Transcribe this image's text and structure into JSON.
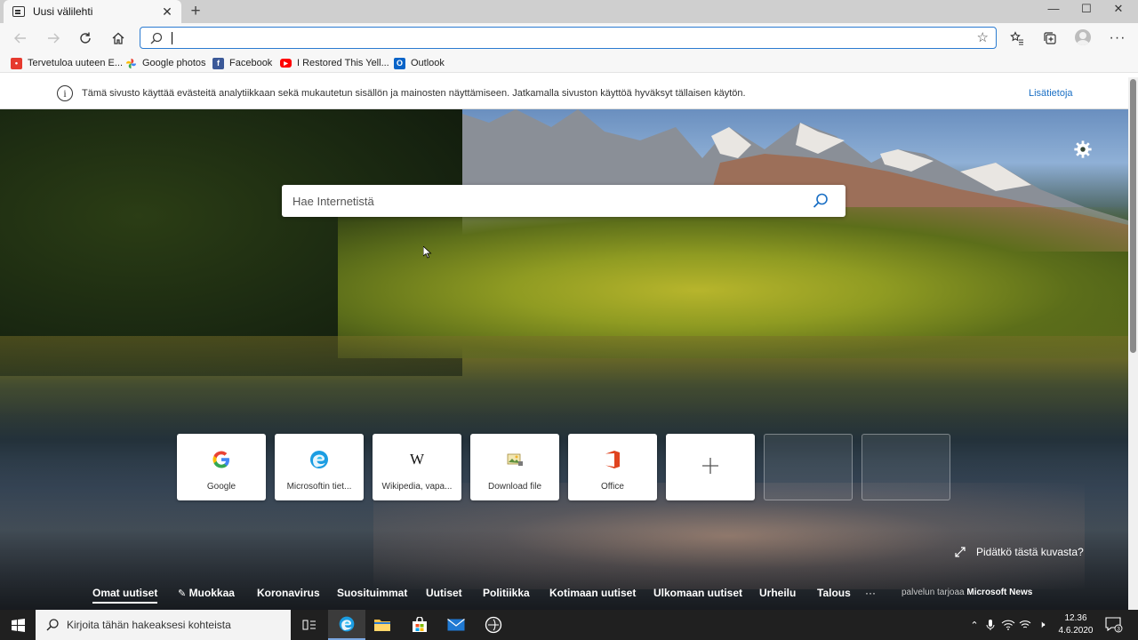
{
  "tab": {
    "title": "Uusi välilehti",
    "close": "✕",
    "new_tab": "+"
  },
  "window": {
    "minimize": "—",
    "maximize": "☐",
    "close": "✕"
  },
  "address_bar": {
    "value": "",
    "placeholder": ""
  },
  "favorites": [
    {
      "label": "Tervetuloa uuteen E...",
      "icon": "welcome-icon",
      "color": "#e63a2e"
    },
    {
      "label": "Google photos",
      "icon": "pinwheel-icon",
      "color": "#fbbc05"
    },
    {
      "label": "Facebook",
      "icon": "facebook-icon",
      "color": "#3b5998"
    },
    {
      "label": "I Restored This Yell...",
      "icon": "youtube-icon",
      "color": "#ff0000"
    },
    {
      "label": "Outlook",
      "icon": "outlook-icon",
      "color": "#0a64c8"
    }
  ],
  "notice": {
    "text": "Tämä sivusto käyttää evästeitä analytiikkaan sekä mukautetun sisällön ja mainosten näyttämiseen. Jatkamalla sivuston käyttöä hyväksyt tällaisen käytön.",
    "link": "Lisätietoja",
    "info_glyph": "i"
  },
  "search": {
    "placeholder": "Hae Internetistä"
  },
  "quick_links": [
    {
      "label": "Google",
      "icon": "google-icon"
    },
    {
      "label": "Microsoftin tiet...",
      "icon": "edge-icon"
    },
    {
      "label": "Wikipedia, vapa...",
      "icon": "wikipedia-icon",
      "glyph": "W"
    },
    {
      "label": "Download file",
      "icon": "download-file-icon"
    },
    {
      "label": "Office",
      "icon": "office-icon"
    }
  ],
  "photo_question": "Pidätkö tästä kuvasta?",
  "news_nav": {
    "items": [
      "Omat uutiset",
      "Muokkaa",
      "Koronavirus",
      "Suosituimmat",
      "Uutiset",
      "Politiikka",
      "Kotimaan uutiset",
      "Ulkomaan uutiset",
      "Urheilu",
      "Talous"
    ],
    "more": "···",
    "provider_prefix": "palvelun tarjoaa",
    "provider_name": "Microsoft News",
    "edit_glyph": "✎"
  },
  "taskbar": {
    "search_placeholder": "Kirjoita tähän hakeaksesi kohteista",
    "clock_time": "12.36",
    "clock_date": "4.6.2020",
    "notification_count": "3",
    "tray_chevron": "⌃",
    "tray_volume": "🕨"
  },
  "colors": {
    "accent": "#2b7bd1",
    "link": "#1a6fc4",
    "taskbar": "#202020"
  }
}
